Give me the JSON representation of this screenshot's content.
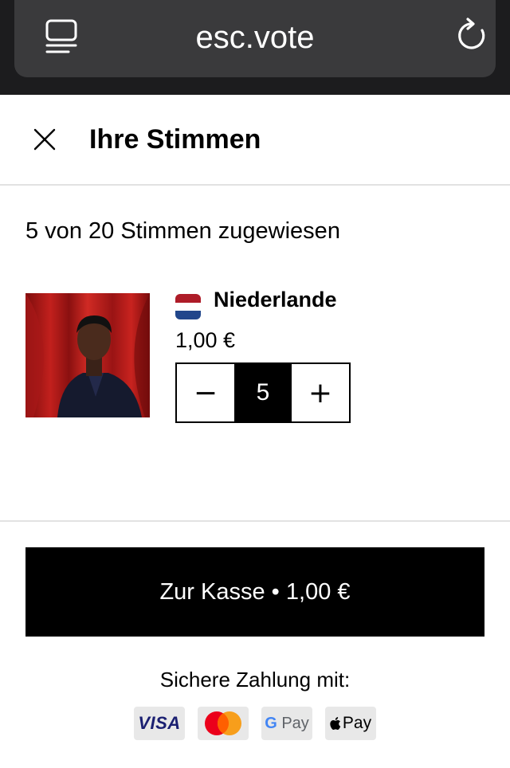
{
  "browser": {
    "url": "esc.vote",
    "tabs_icon": "tabs-icon",
    "reload_icon": "reload-icon"
  },
  "header": {
    "title": "Ihre Stimmen",
    "close_icon": "close-icon"
  },
  "summary": "5 von 20 Stimmen zugewiesen",
  "item": {
    "country": "Niederlande",
    "flag_colors": [
      "#ae1c28",
      "#ffffff",
      "#21468b"
    ],
    "price": "1,00 €",
    "quantity": "5",
    "decrement_label": "−",
    "increment_label": "+"
  },
  "checkout": {
    "label": "Zur Kasse • 1,00 €"
  },
  "payment": {
    "heading": "Sichere Zahlung mit:",
    "methods": [
      {
        "name": "visa",
        "label": "VISA"
      },
      {
        "name": "mastercard",
        "label": ""
      },
      {
        "name": "google-pay",
        "label_g": "G",
        "label": "Pay"
      },
      {
        "name": "apple-pay",
        "label": "Pay"
      }
    ]
  }
}
